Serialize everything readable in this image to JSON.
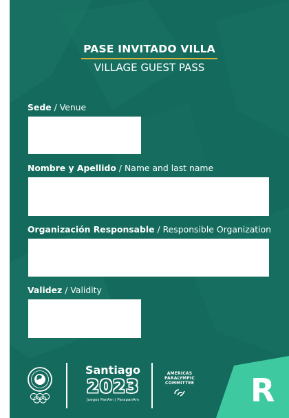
{
  "pass": {
    "title_es": "PASE INVITADO VILLA",
    "title_en": "VILLAGE GUEST PASS"
  },
  "fields": [
    {
      "label_es": "Sede",
      "label_en": "Venue"
    },
    {
      "label_es": "Nombre y Apellido",
      "label_en": "Name and last name"
    },
    {
      "label_es": "Organización Responsable",
      "label_en": "Responsible Organization"
    },
    {
      "label_es": "Validez",
      "label_en": "Validity"
    }
  ],
  "separator": "/",
  "footer": {
    "santiago_word": "Santiago",
    "santiago_year": "2023",
    "santiago_sub": "Juegos PanAm | ParapanAm",
    "apc_line1": "AMERICAS",
    "apc_line2": "PARALYMPIC",
    "apc_line3": "COMMITTEE",
    "corner_letter": "R"
  },
  "colors": {
    "card_bg": "#146a5c",
    "title_rule": "#d6b23a",
    "corner_accent": "#3fc9a0"
  }
}
